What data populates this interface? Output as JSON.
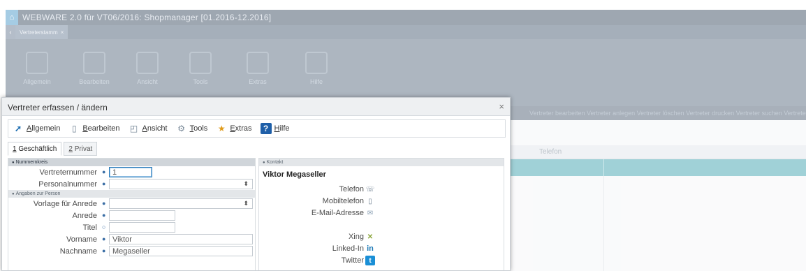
{
  "app": {
    "title": "WEBWARE 2.0 für VT06/2016: Shopmanager  [01.2016-12.2016]",
    "tab_label": "Vertreterstamm",
    "tab_close": "×",
    "home_icon": "home-icon",
    "back_icon": "chevron-left-icon"
  },
  "ribbon": {
    "items": [
      {
        "label": "Allgemein",
        "icon": "arrow-icon"
      },
      {
        "label": "Bearbeiten",
        "icon": "document-icon"
      },
      {
        "label": "Ansicht",
        "icon": "view-icon"
      },
      {
        "label": "Tools",
        "icon": "gears-icon"
      },
      {
        "label": "Extras",
        "icon": "extras-icon"
      },
      {
        "label": "Hilfe",
        "icon": "help-icon"
      }
    ]
  },
  "background": {
    "strip_text": "Vertreter bearbeiten   Vertreter anlegen   Vertreter löschen   Vertreter drucken   Vertreter suchen   Vertreter kopieren",
    "grid_header": "Telefon"
  },
  "dialog": {
    "title": "Vertreter erfassen / ändern",
    "close": "×",
    "menu": [
      {
        "label": "Allgemein",
        "icon": "arrow-icon",
        "glyph": "➚",
        "color": "#1f6fb2"
      },
      {
        "label": "Bearbeiten",
        "icon": "document-icon",
        "glyph": "▯",
        "color": "#6b7d8f"
      },
      {
        "label": "Ansicht",
        "icon": "view-icon",
        "glyph": "◰",
        "color": "#6b7d8f"
      },
      {
        "label": "Tools",
        "icon": "gears-icon",
        "glyph": "⚙",
        "color": "#7a8a99"
      },
      {
        "label": "Extras",
        "icon": "extras-icon",
        "glyph": "★",
        "color": "#e09b1a"
      },
      {
        "label": "Hilfe",
        "icon": "help-icon",
        "glyph": "?",
        "color": "#ffffff"
      }
    ],
    "tabs": [
      {
        "label": "1 Geschäftlich",
        "active": true
      },
      {
        "label": "2 Privat",
        "active": false
      }
    ],
    "sections": {
      "nummernkreis": "Nummernkreis",
      "angaben": "Angaben zur Person",
      "kontakt": "Kontakt"
    },
    "fields": {
      "vertreternummer": {
        "label": "Vertreternummer",
        "mark": "●",
        "value": "1"
      },
      "personalnummer": {
        "label": "Personalnummer",
        "mark": "●",
        "value": ""
      },
      "vorlage_anrede": {
        "label": "Vorlage für Anrede",
        "mark": "●",
        "value": ""
      },
      "anrede": {
        "label": "Anrede",
        "mark": "●",
        "value": ""
      },
      "titel": {
        "label": "Titel",
        "mark": "○",
        "value": ""
      },
      "vorname": {
        "label": "Vorname",
        "mark": "●",
        "value": "Viktor"
      },
      "nachname": {
        "label": "Nachname",
        "mark": "●",
        "value": "Megaseller"
      }
    },
    "contact": {
      "name": "Viktor Megaseller",
      "rows": [
        {
          "label": "Telefon",
          "icon": "phone-icon",
          "glyph": "☏",
          "color": "#6b7d8f"
        },
        {
          "label": "Mobiltelefon",
          "icon": "mobile-icon",
          "glyph": "▯",
          "color": "#6b7d8f"
        },
        {
          "label": "E-Mail-Adresse",
          "icon": "mail-icon",
          "glyph": "✉",
          "color": "#8aa0b4"
        },
        {
          "label": "Xing",
          "icon": "xing-icon",
          "glyph": "✕",
          "color": "#8aa53a"
        },
        {
          "label": "Linked-In",
          "icon": "linkedin-icon",
          "glyph": "in",
          "color": "#1a77b5"
        },
        {
          "label": "Twitter",
          "icon": "twitter-icon",
          "glyph": "t",
          "color": "#ffffff"
        }
      ]
    }
  }
}
